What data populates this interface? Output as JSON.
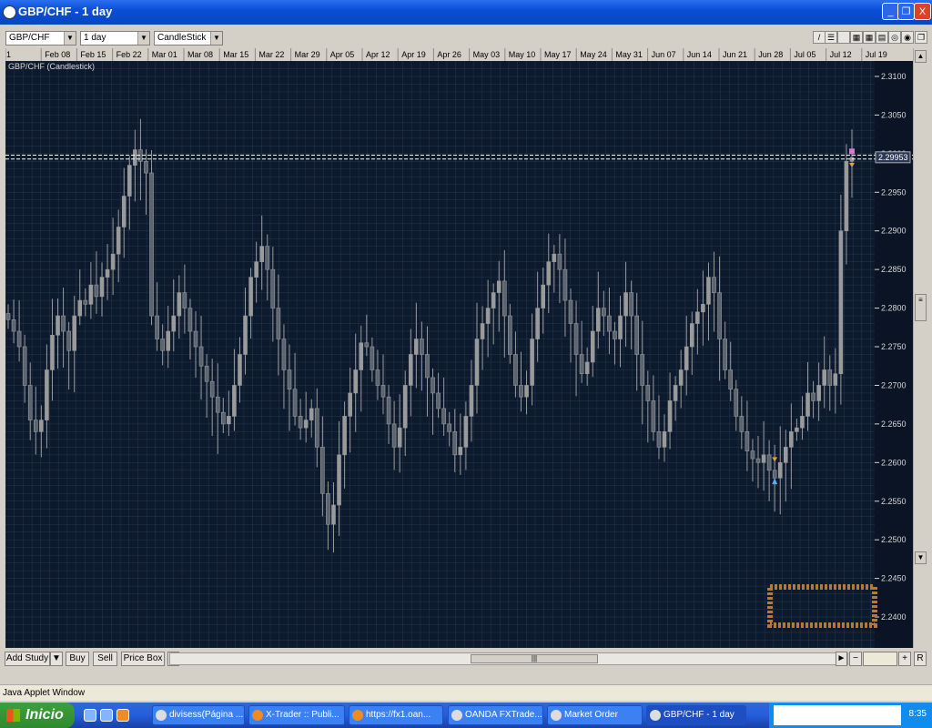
{
  "window": {
    "title": "GBP/CHF - 1 day",
    "minimize_label": "_",
    "maximize_label": "❐",
    "close_label": "X"
  },
  "toolbar": {
    "instrument": "GBP/CHF",
    "interval": "1 day",
    "chart_type": "CandleStick",
    "tool_icons": [
      "draw-line-icon",
      "grid-icon",
      "blank-icon",
      "table-icon",
      "table-icon-2",
      "grid-icon-2",
      "zoom-icon",
      "target-icon",
      "restore-icon"
    ]
  },
  "chart": {
    "caption": "GBP/CHF (Candlestick)",
    "current_price_label": "2.29953",
    "colors": {
      "background": "#0d1a2e",
      "grid": "#26374f",
      "candle": "#9a9a9a",
      "axis_bg": "#0a1424",
      "axis_text": "#d8d8d8",
      "sell_marker": "#e0a030",
      "buy_marker": "#5aa7ff",
      "top_marker": "#d47ad4",
      "price_line": "#ffffff"
    }
  },
  "chart_data": {
    "type": "candlestick",
    "title": "GBP/CHF (Candlestick)",
    "xlabel": "",
    "ylabel": "",
    "ylim": [
      2.236,
      2.312
    ],
    "y_ticks": [
      2.24,
      2.245,
      2.25,
      2.255,
      2.26,
      2.265,
      2.27,
      2.275,
      2.28,
      2.285,
      2.29,
      2.295,
      2.3,
      2.305,
      2.31
    ],
    "y_tick_labels": [
      "2.2400",
      "2.2450",
      "2.2500",
      "2.2550",
      "2.2600",
      "2.2650",
      "2.2700",
      "2.2750",
      "2.2800",
      "2.2850",
      "2.2900",
      "2.2950",
      "2.3000",
      "2.3050",
      "2.3100"
    ],
    "x_tick_labels": [
      "1",
      "Feb 08",
      "Feb 15",
      "Feb 22",
      "Mar 01",
      "Mar 08",
      "Mar 15",
      "Mar 22",
      "Mar 29",
      "Apr 05",
      "Apr 12",
      "Apr 19",
      "Apr 26",
      "May 03",
      "May 10",
      "May 17",
      "May 24",
      "May 31",
      "Jun 07",
      "Jun 14",
      "Jun 21",
      "Jun 28",
      "Jul 05",
      "Jul 12",
      "Jul 19"
    ],
    "dashed_levels": [
      2.2998,
      2.2993
    ],
    "current_price": 2.29953,
    "grid": true,
    "closes": [
      2.2785,
      2.277,
      2.275,
      2.27,
      2.2655,
      2.264,
      2.2655,
      2.272,
      2.2765,
      2.279,
      2.277,
      2.2745,
      2.279,
      2.281,
      2.2805,
      2.283,
      2.2815,
      2.284,
      2.285,
      2.287,
      2.2905,
      2.2945,
      2.2985,
      2.3005,
      2.299,
      2.2975,
      2.279,
      2.276,
      2.2745,
      2.277,
      2.279,
      2.282,
      2.28,
      2.277,
      2.275,
      2.2725,
      2.2705,
      2.2685,
      2.2665,
      2.265,
      2.266,
      2.27,
      2.274,
      2.279,
      2.284,
      2.286,
      2.288,
      2.285,
      2.28,
      2.276,
      2.272,
      2.2695,
      2.266,
      2.2645,
      2.2655,
      2.267,
      2.262,
      2.256,
      2.252,
      2.2545,
      2.261,
      2.266,
      2.269,
      2.272,
      2.2755,
      2.275,
      2.272,
      2.27,
      2.2685,
      2.265,
      2.262,
      2.2645,
      2.27,
      2.274,
      2.276,
      2.274,
      2.271,
      2.269,
      2.267,
      2.265,
      2.264,
      2.261,
      2.262,
      2.266,
      2.27,
      2.276,
      2.278,
      2.28,
      2.282,
      2.2835,
      2.279,
      2.274,
      2.27,
      2.2685,
      2.27,
      2.276,
      2.28,
      2.283,
      2.286,
      2.287,
      2.285,
      2.281,
      2.278,
      2.274,
      2.2715,
      2.273,
      2.277,
      2.28,
      2.279,
      2.277,
      2.276,
      2.279,
      2.282,
      2.279,
      2.274,
      2.27,
      2.268,
      2.264,
      2.262,
      2.264,
      2.268,
      2.27,
      2.272,
      2.275,
      2.278,
      2.2795,
      2.2805,
      2.284,
      2.282,
      2.276,
      2.272,
      2.2695,
      2.266,
      2.264,
      2.2615,
      2.2605,
      2.26,
      2.261,
      2.259,
      2.258,
      2.26,
      2.262,
      2.264,
      2.2645,
      2.266,
      2.269,
      2.268,
      2.27,
      2.272,
      2.27,
      2.2715,
      2.29,
      2.299,
      2.2995
    ]
  },
  "bottom": {
    "add_study": "Add Study",
    "dropdown": "▼",
    "buy": "Buy",
    "sell": "Sell",
    "price_box": "Price Box",
    "scroll_left": "◄",
    "scroll_right": "►",
    "thumb": "|||",
    "zoom_out": "−",
    "zoom_in": "+",
    "reset": "R"
  },
  "status": {
    "text": "Java Applet Window"
  },
  "taskbar": {
    "start": "Inicio",
    "tasks": [
      "divisess(Página ...",
      "X-Trader :: Publi...",
      "https://fx1.oan...",
      "OANDA FXTrade...",
      "Market Order",
      "GBP/CHF - 1 day"
    ],
    "clock": "8:35"
  }
}
